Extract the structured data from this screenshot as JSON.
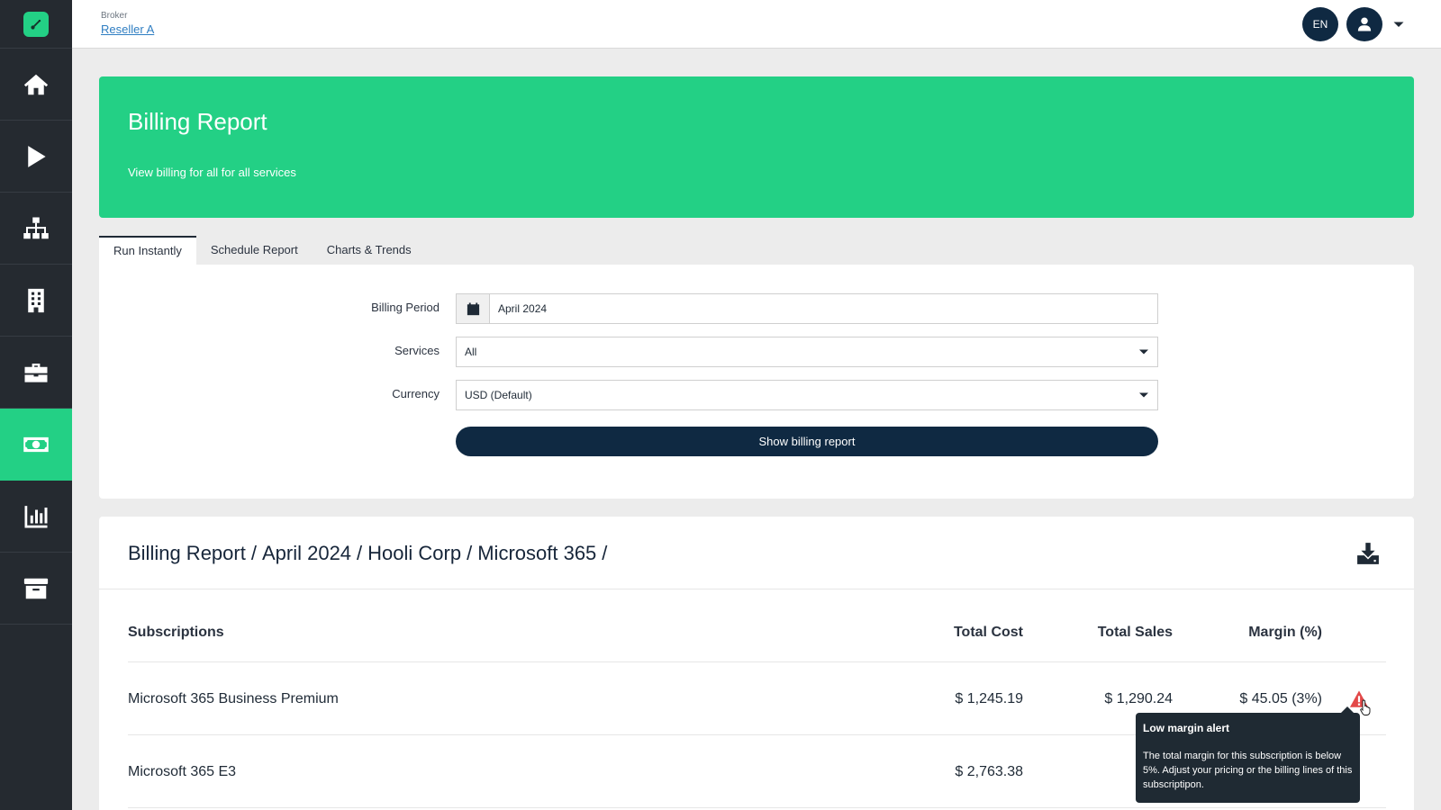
{
  "header": {
    "broker_label": "Broker",
    "broker_name": "Reseller A",
    "language": "EN"
  },
  "sidebar": {
    "items": [
      {
        "icon": "home-icon"
      },
      {
        "icon": "play-icon"
      },
      {
        "icon": "sitemap-icon"
      },
      {
        "icon": "building-icon"
      },
      {
        "icon": "briefcase-icon"
      },
      {
        "icon": "money-bill-icon",
        "active": true
      },
      {
        "icon": "chart-bar-icon"
      },
      {
        "icon": "archive-icon"
      }
    ]
  },
  "banner": {
    "title": "Billing Report",
    "subtitle": "View billing for all for all services"
  },
  "tabs": [
    {
      "label": "Run Instantly",
      "active": true
    },
    {
      "label": "Schedule Report"
    },
    {
      "label": "Charts & Trends"
    }
  ],
  "form": {
    "billing_period_label": "Billing Period",
    "billing_period_value": "April 2024",
    "services_label": "Services",
    "services_value": "All",
    "currency_label": "Currency",
    "currency_value": "USD (Default)",
    "submit_label": "Show billing report"
  },
  "report": {
    "breadcrumb": [
      "Billing Report",
      "April 2024",
      "Hooli Corp",
      "Microsoft 365"
    ],
    "separator": "/",
    "columns": {
      "subscriptions": "Subscriptions",
      "total_cost": "Total Cost",
      "total_sales": "Total Sales",
      "margin": "Margin (%)"
    },
    "rows": [
      {
        "name": "Microsoft 365 Business Premium",
        "cost": "$ 1,245.19",
        "sales": "$ 1,290.24",
        "margin": "$ 45.05 (3%)",
        "alert": true
      },
      {
        "name": "Microsoft 365 E3",
        "cost": "$ 2,763.38",
        "sales": "$ 3,4",
        "margin": "",
        "alert": false
      }
    ]
  },
  "tooltip": {
    "title": "Low margin alert",
    "body": "The total margin for this subscription is below 5%. Adjust your pricing or the billing lines of this subscriptipon."
  },
  "colors": {
    "brand_green": "#23d085",
    "navy": "#0f2942",
    "sidebar_bg": "#252a30",
    "alert_red": "#e34848"
  }
}
